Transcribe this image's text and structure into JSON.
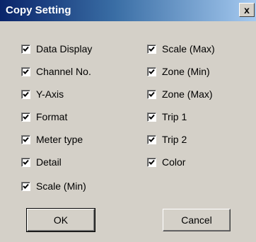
{
  "window": {
    "title": "Copy Setting",
    "close_glyph": "x",
    "close_icon": "close-icon"
  },
  "options": {
    "left": [
      {
        "label": "Data Display",
        "checked": true
      },
      {
        "label": "Channel No.",
        "checked": true
      },
      {
        "label": "Y-Axis",
        "checked": true
      },
      {
        "label": "Format",
        "checked": true
      },
      {
        "label": "Meter type",
        "checked": true
      },
      {
        "label": "Detail",
        "checked": true
      },
      {
        "label": "Scale (Min)",
        "checked": true
      }
    ],
    "right": [
      {
        "label": "Scale (Max)",
        "checked": true
      },
      {
        "label": "Zone (Min)",
        "checked": true
      },
      {
        "label": "Zone (Max)",
        "checked": true
      },
      {
        "label": "Trip 1",
        "checked": true
      },
      {
        "label": "Trip 2",
        "checked": true
      },
      {
        "label": "Color",
        "checked": true
      }
    ]
  },
  "buttons": {
    "ok_label": "OK",
    "cancel_label": "Cancel"
  },
  "colors": {
    "titlebar_start": "#0a246a",
    "titlebar_end": "#a6caf0",
    "face": "#d4d0c8"
  }
}
